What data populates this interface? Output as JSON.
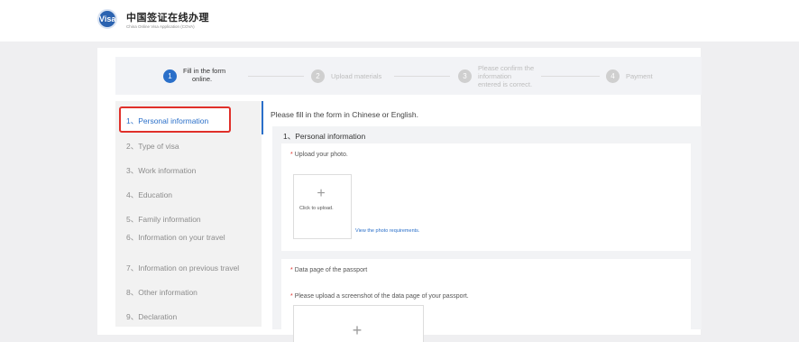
{
  "header": {
    "logo_mark": "Visa",
    "title": "中国签证在线办理",
    "subtitle": "China Online Visa Application (COVA)"
  },
  "steps": [
    {
      "number": "1",
      "label_line1": "Fill in the form",
      "label_line2": "online.",
      "label_line3": "",
      "state": "active"
    },
    {
      "number": "2",
      "label_line1": "Upload materials",
      "label_line2": "",
      "label_line3": "",
      "state": "inactive"
    },
    {
      "number": "3",
      "label_line1": "Please confirm the",
      "label_line2": "information",
      "label_line3": "entered is correct.",
      "state": "inactive"
    },
    {
      "number": "4",
      "label_line1": "Payment",
      "label_line2": "",
      "label_line3": "",
      "state": "inactive"
    }
  ],
  "sidebar": {
    "items": [
      {
        "label": "1、Personal information",
        "active": true
      },
      {
        "label": "2、Type of visa"
      },
      {
        "label": "3、Work information"
      },
      {
        "label": "4、Education"
      },
      {
        "label": "5、Family information"
      },
      {
        "label": "6、Information on your travel"
      },
      {
        "label": "7、Information on previous travel"
      },
      {
        "label": "8、Other information"
      },
      {
        "label": "9、Declaration"
      }
    ]
  },
  "main": {
    "intro": "Please fill in the form in Chinese or English.",
    "section_title": "1、Personal information",
    "photo": {
      "label": "Upload your photo.",
      "upload_text": "Click to upload.",
      "requirements_link": "View the photo requirements."
    },
    "passport": {
      "label": "Data page of the passport",
      "instruction": "Please upload a screenshot of the data page of your passport."
    }
  },
  "colors": {
    "accent": "#2a6fc9",
    "required": "#e0302a",
    "highlight_border": "#e0302a"
  }
}
